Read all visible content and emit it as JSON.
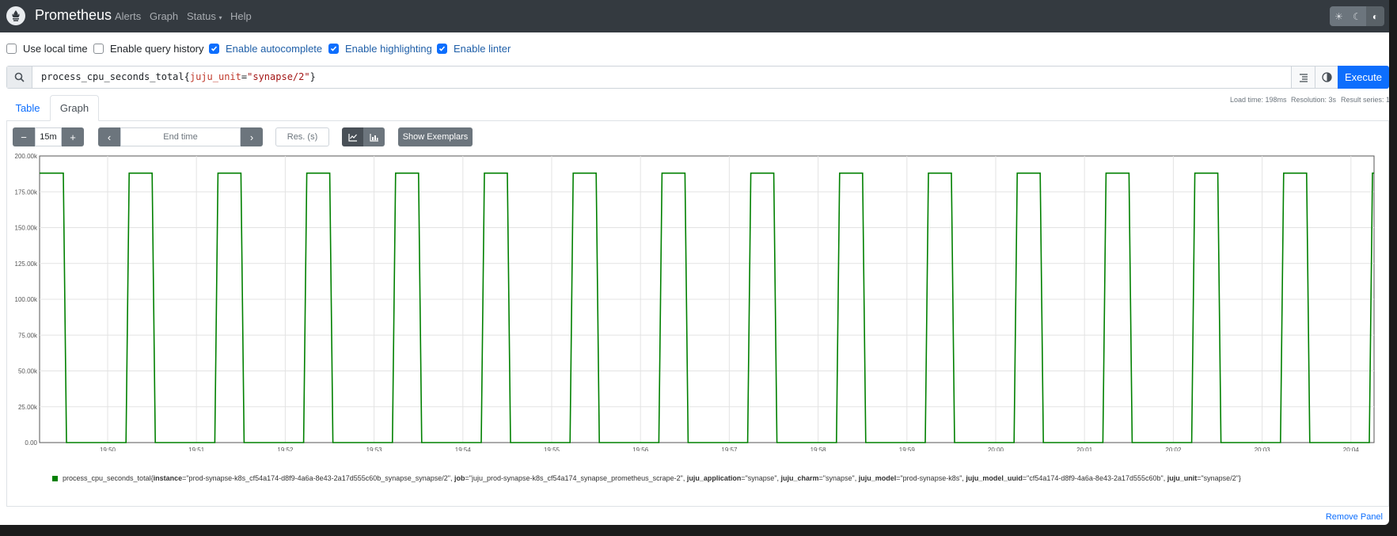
{
  "navbar": {
    "brand": "Prometheus",
    "links": [
      "Alerts",
      "Graph",
      "Status",
      "Help"
    ]
  },
  "options": [
    {
      "label": "Use local time",
      "checked": false
    },
    {
      "label": "Enable query history",
      "checked": false
    },
    {
      "label": "Enable autocomplete",
      "checked": true
    },
    {
      "label": "Enable highlighting",
      "checked": true
    },
    {
      "label": "Enable linter",
      "checked": true
    }
  ],
  "expression": {
    "metric": "process_cpu_seconds_total",
    "label_name": "juju_unit",
    "label_value": "\"synapse/2\""
  },
  "execute_label": "Execute",
  "stats": {
    "load_time": "Load time: 198ms",
    "resolution": "Resolution: 3s",
    "result_series": "Result series: 1"
  },
  "tabs": {
    "table": "Table",
    "graph": "Graph"
  },
  "controls": {
    "range": "15m",
    "end_time_placeholder": "End time",
    "res_placeholder": "Res. (s)",
    "show_exemplars": "Show Exemplars"
  },
  "chart_data": {
    "type": "line",
    "y_ticks": [
      "0.00",
      "25.00k",
      "50.00k",
      "75.00k",
      "100.00k",
      "125.00k",
      "150.00k",
      "175.00k",
      "200.00k"
    ],
    "ylim": [
      0,
      200000
    ],
    "x_ticks": [
      "19:50",
      "19:51",
      "19:52",
      "19:53",
      "19:54",
      "19:55",
      "19:56",
      "19:57",
      "19:58",
      "19:59",
      "20:00",
      "20:01",
      "20:02",
      "20:03",
      "20:04"
    ],
    "grid": true,
    "series": [
      {
        "color": "#008000",
        "pattern": "square wave alternating between ~188000 and 0, period ~1 minute",
        "high_value": 188000,
        "low_value": 0
      }
    ]
  },
  "legend": {
    "metric": "process_cpu_seconds_total",
    "labels": [
      {
        "key": "instance",
        "value": "\"prod-synapse-k8s_cf54a174-d8f9-4a6a-8e43-2a17d555c60b_synapse_synapse/2\""
      },
      {
        "key": "job",
        "value": "\"juju_prod-synapse-k8s_cf54a174_synapse_prometheus_scrape-2\""
      },
      {
        "key": "juju_application",
        "value": "\"synapse\""
      },
      {
        "key": "juju_charm",
        "value": "\"synapse\""
      },
      {
        "key": "juju_model",
        "value": "\"prod-synapse-k8s\""
      },
      {
        "key": "juju_model_uuid",
        "value": "\"cf54a174-d8f9-4a6a-8e43-2a17d555c60b\""
      },
      {
        "key": "juju_unit",
        "value": "\"synapse/2\""
      }
    ]
  },
  "remove_panel": "Remove Panel"
}
